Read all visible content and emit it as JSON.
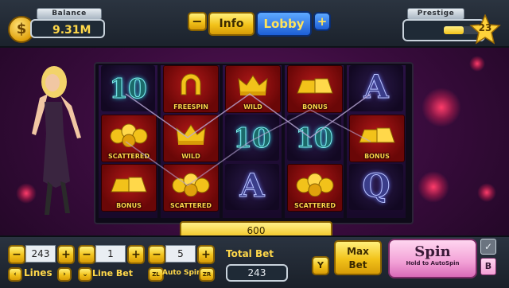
{
  "balance": {
    "label": "Balance",
    "value": "9.31M"
  },
  "prestige": {
    "label": "Prestige",
    "level": "23",
    "progress": 0.55
  },
  "nav": {
    "minus": "−",
    "info": "Info",
    "lobby": "Lobby",
    "plus": "+"
  },
  "reels": [
    [
      {
        "kind": "ten",
        "label": ""
      },
      {
        "kind": "coins",
        "label": "SCATTERED"
      },
      {
        "kind": "bars",
        "label": "BONUS"
      }
    ],
    [
      {
        "kind": "horseshoe",
        "label": "FREESPIN"
      },
      {
        "kind": "crown",
        "label": "WILD"
      },
      {
        "kind": "coins",
        "label": "SCATTERED"
      }
    ],
    [
      {
        "kind": "crown",
        "label": "WILD"
      },
      {
        "kind": "ten",
        "label": ""
      },
      {
        "kind": "letter",
        "glyph": "A",
        "label": ""
      }
    ],
    [
      {
        "kind": "bars",
        "label": "BONUS"
      },
      {
        "kind": "ten",
        "label": ""
      },
      {
        "kind": "coins",
        "label": "SCATTERED"
      }
    ],
    [
      {
        "kind": "letter",
        "glyph": "A",
        "label": ""
      },
      {
        "kind": "bars",
        "label": "BONUS"
      },
      {
        "kind": "letter",
        "glyph": "Q",
        "label": ""
      }
    ]
  ],
  "ten_glyph": "10",
  "win_display": "600",
  "controls": {
    "lines": {
      "value": "243",
      "label": "Lines",
      "minus": "−",
      "plus": "+",
      "left": "‹",
      "right": "›"
    },
    "line_bet": {
      "value": "1",
      "label": "Line Bet",
      "minus": "−",
      "plus": "+",
      "chevron": "⌄"
    },
    "auto_spins": {
      "value": "5",
      "label": "Auto Spins",
      "minus": "−",
      "plus": "+",
      "left_key": "ZL",
      "right_key": "ZR"
    },
    "total_bet": {
      "label": "Total Bet",
      "value": "243"
    },
    "y_key": "Y",
    "max_bet": {
      "line1": "Max",
      "line2": "Bet"
    },
    "spin": {
      "label": "Spin",
      "sub": "Hold to AutoSpin"
    },
    "check": "✓",
    "b_key": "B"
  },
  "colors": {
    "accent_yellow": "#f2c21a",
    "spin_pink": "#f2a0d6",
    "reel_red": "#b01818"
  }
}
